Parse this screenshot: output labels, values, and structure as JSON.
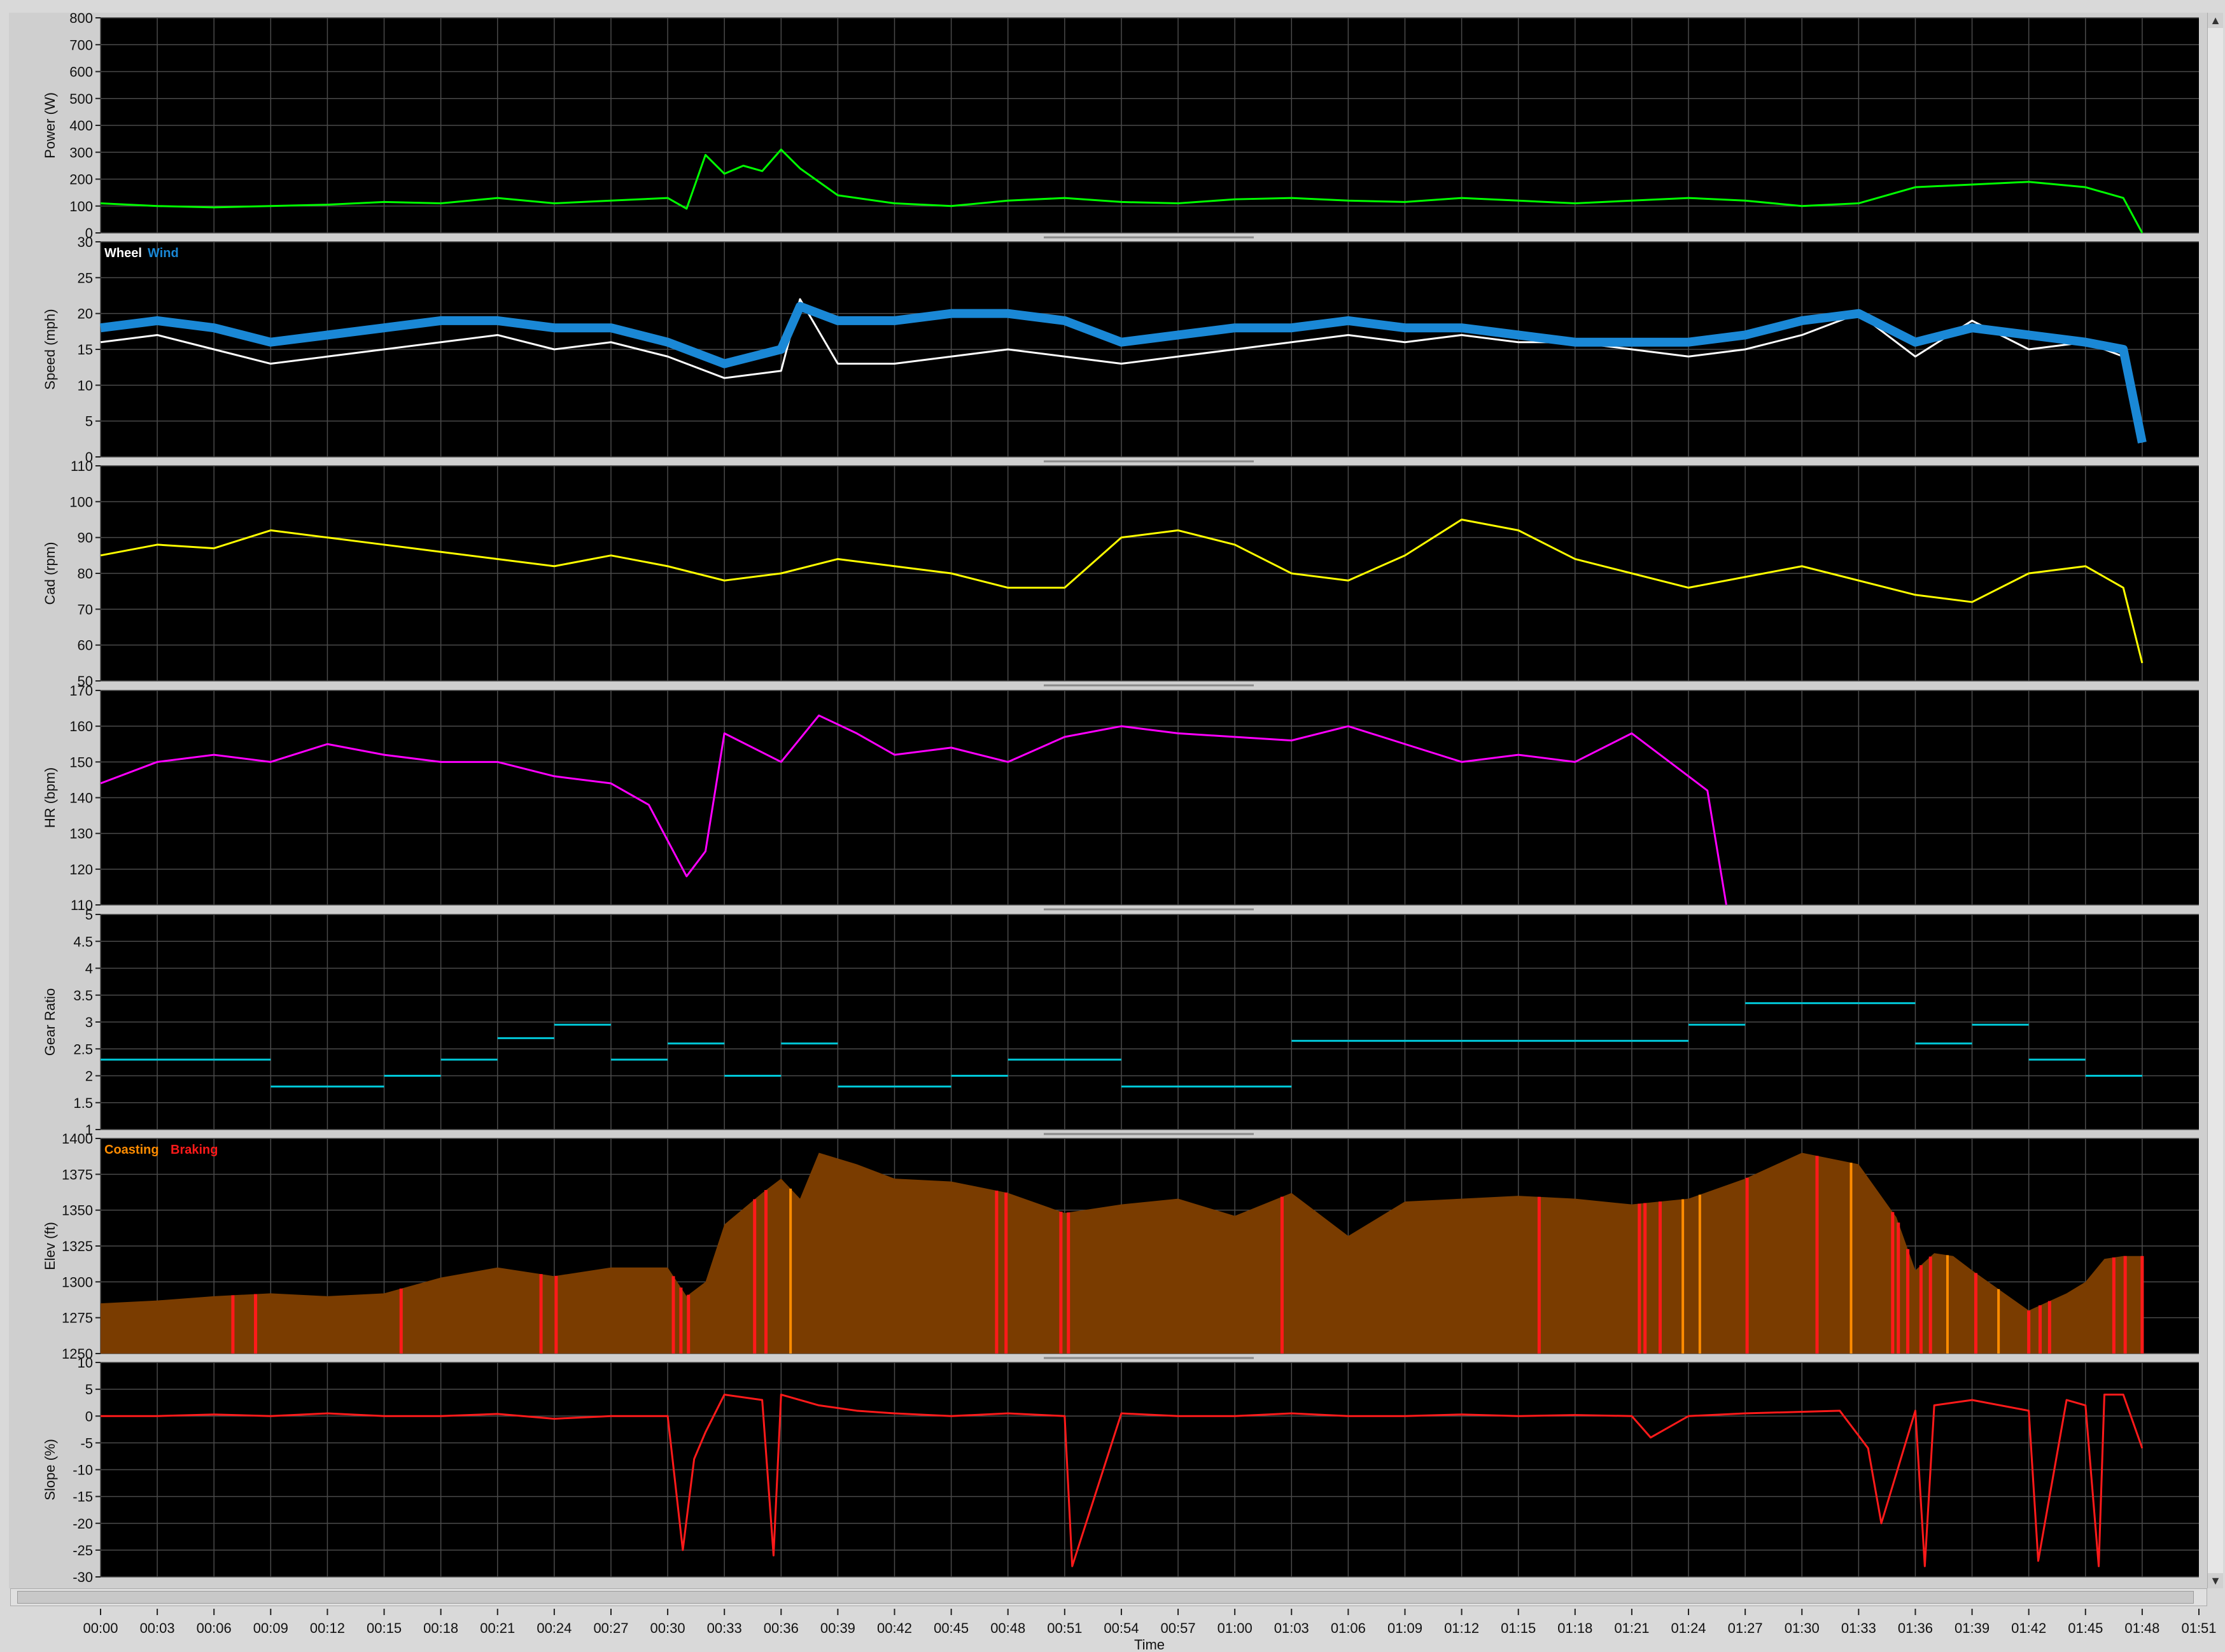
{
  "colors": {
    "power": "#00ff00",
    "wheel": "#ffffff",
    "wind": "#1a88d6",
    "cadence": "#ffff00",
    "hr": "#ff00ff",
    "gear": "#00c8d8",
    "elev_fill": "#7a3c00",
    "coasting": "#ff8c00",
    "braking": "#ff1a1a",
    "slope": "#ff1a1a"
  },
  "chart_data": [
    {
      "type": "line",
      "ylabel": "Power (W)",
      "ylim": [
        0,
        800
      ],
      "ticks": [
        "800",
        "700",
        "600",
        "500",
        "400",
        "300",
        "200",
        "100",
        "0"
      ],
      "series": [
        {
          "x": [
            0,
            3,
            6,
            9,
            12,
            15,
            18,
            21,
            24,
            27,
            30,
            31,
            32,
            33,
            34,
            35,
            36,
            37,
            38,
            39,
            42,
            45,
            48,
            51,
            54,
            57,
            60,
            63,
            66,
            69,
            72,
            75,
            78,
            81,
            84,
            87,
            90,
            93,
            96,
            99,
            102,
            105,
            107,
            108
          ],
          "values": [
            110,
            100,
            95,
            100,
            105,
            115,
            110,
            130,
            110,
            120,
            130,
            90,
            290,
            220,
            250,
            230,
            310,
            240,
            190,
            140,
            110,
            100,
            120,
            130,
            115,
            110,
            125,
            130,
            120,
            115,
            130,
            120,
            110,
            120,
            130,
            120,
            100,
            110,
            170,
            180,
            190,
            170,
            130,
            0
          ]
        }
      ]
    },
    {
      "type": "line",
      "ylabel": "Speed (mph)",
      "ylim": [
        0,
        30
      ],
      "ticks": [
        "30",
        "25",
        "20",
        "15",
        "10",
        "5",
        "0"
      ],
      "legend": [
        "Wheel",
        "Wind"
      ],
      "series": [
        {
          "name": "Wheel",
          "x": [
            0,
            3,
            6,
            9,
            12,
            15,
            18,
            21,
            24,
            27,
            30,
            33,
            36,
            37,
            39,
            42,
            45,
            48,
            51,
            54,
            57,
            60,
            63,
            66,
            69,
            72,
            75,
            78,
            81,
            84,
            87,
            90,
            93,
            96,
            99,
            102,
            105,
            107,
            108
          ],
          "values": [
            16,
            17,
            15,
            13,
            14,
            15,
            16,
            17,
            15,
            16,
            14,
            11,
            12,
            22,
            13,
            13,
            14,
            15,
            14,
            13,
            14,
            15,
            16,
            17,
            16,
            17,
            16,
            16,
            15,
            14,
            15,
            17,
            20,
            14,
            19,
            15,
            16,
            14,
            2
          ]
        },
        {
          "name": "Wind",
          "x": [
            0,
            3,
            6,
            9,
            12,
            15,
            18,
            21,
            24,
            27,
            30,
            33,
            36,
            37,
            39,
            42,
            45,
            48,
            51,
            54,
            57,
            60,
            63,
            66,
            69,
            72,
            75,
            78,
            81,
            84,
            87,
            90,
            93,
            96,
            99,
            102,
            105,
            107,
            108
          ],
          "values": [
            18,
            19,
            18,
            16,
            17,
            18,
            19,
            19,
            18,
            18,
            16,
            13,
            15,
            21,
            19,
            19,
            20,
            20,
            19,
            16,
            17,
            18,
            18,
            19,
            18,
            18,
            17,
            16,
            16,
            16,
            17,
            19,
            20,
            16,
            18,
            17,
            16,
            15,
            2
          ]
        }
      ]
    },
    {
      "type": "line",
      "ylabel": "Cad (rpm)",
      "ylim": [
        50,
        110
      ],
      "ticks": [
        "110",
        "100",
        "90",
        "80",
        "70",
        "60",
        "50"
      ],
      "series": [
        {
          "x": [
            0,
            3,
            6,
            9,
            12,
            15,
            18,
            21,
            24,
            27,
            30,
            33,
            36,
            39,
            42,
            45,
            48,
            51,
            54,
            57,
            60,
            63,
            66,
            69,
            72,
            75,
            78,
            81,
            84,
            87,
            90,
            93,
            96,
            99,
            102,
            105,
            107,
            108
          ],
          "values": [
            85,
            88,
            87,
            92,
            90,
            88,
            86,
            84,
            82,
            85,
            82,
            78,
            80,
            84,
            82,
            80,
            76,
            76,
            90,
            92,
            88,
            80,
            78,
            85,
            95,
            92,
            84,
            80,
            76,
            79,
            82,
            78,
            74,
            72,
            80,
            82,
            76,
            55
          ]
        }
      ]
    },
    {
      "type": "line",
      "ylabel": "HR (bpm)",
      "ylim": [
        110,
        170
      ],
      "ticks": [
        "170",
        "160",
        "150",
        "140",
        "130",
        "120",
        "110"
      ],
      "series": [
        {
          "x": [
            0,
            3,
            6,
            9,
            12,
            15,
            18,
            21,
            24,
            27,
            29,
            31,
            32,
            33,
            36,
            38,
            40,
            42,
            45,
            48,
            51,
            54,
            57,
            60,
            63,
            66,
            69,
            72,
            75,
            78,
            81,
            83,
            85,
            86
          ],
          "values": [
            144,
            150,
            152,
            150,
            155,
            152,
            150,
            150,
            146,
            144,
            138,
            118,
            125,
            158,
            150,
            163,
            158,
            152,
            154,
            150,
            157,
            160,
            158,
            157,
            156,
            160,
            155,
            150,
            152,
            150,
            158,
            150,
            142,
            110
          ]
        }
      ]
    },
    {
      "type": "scatter",
      "ylabel": "Gear Ratio",
      "ylim": [
        1,
        5
      ],
      "ticks": [
        "5",
        "4.5",
        "4",
        "3.5",
        "3",
        "2.5",
        "2",
        "1.5",
        "1"
      ],
      "series": [
        {
          "x": [
            0,
            3,
            6,
            9,
            12,
            15,
            18,
            21,
            24,
            27,
            30,
            33,
            36,
            39,
            42,
            45,
            48,
            51,
            54,
            57,
            60,
            63,
            66,
            69,
            72,
            75,
            78,
            81,
            84,
            87,
            90,
            93,
            96,
            99,
            102,
            105,
            107,
            108
          ],
          "values": [
            2.3,
            2.3,
            2.3,
            1.8,
            1.8,
            2.0,
            2.3,
            2.7,
            2.95,
            2.3,
            2.6,
            2.0,
            2.6,
            1.8,
            1.8,
            2.0,
            2.3,
            2.3,
            1.8,
            1.8,
            1.8,
            2.65,
            2.65,
            2.65,
            2.65,
            2.65,
            2.65,
            2.65,
            2.95,
            3.35,
            3.35,
            3.35,
            2.6,
            2.95,
            2.3,
            2.0,
            2.0,
            2.0
          ]
        }
      ]
    },
    {
      "type": "area",
      "ylabel": "Elev (ft)",
      "ylim": [
        1250,
        1400
      ],
      "ticks": [
        "1400",
        "1375",
        "1350",
        "1325",
        "1300",
        "1275",
        "1250"
      ],
      "legend": [
        "Coasting",
        "Braking"
      ],
      "series": [
        {
          "x": [
            0,
            3,
            6,
            9,
            12,
            15,
            18,
            21,
            24,
            27,
            30,
            31,
            32,
            33,
            35,
            36,
            37,
            38,
            40,
            42,
            45,
            48,
            51,
            54,
            57,
            60,
            63,
            66,
            69,
            72,
            75,
            78,
            81,
            84,
            87,
            90,
            93,
            95,
            96,
            97,
            98,
            99,
            102,
            104,
            105,
            106,
            107,
            108
          ],
          "values": [
            1285,
            1287,
            1290,
            1292,
            1290,
            1292,
            1303,
            1310,
            1304,
            1310,
            1310,
            1290,
            1300,
            1340,
            1362,
            1372,
            1358,
            1390,
            1382,
            1372,
            1370,
            1362,
            1348,
            1354,
            1358,
            1346,
            1362,
            1332,
            1356,
            1358,
            1360,
            1358,
            1354,
            1358,
            1372,
            1390,
            1382,
            1345,
            1308,
            1320,
            1318,
            1308,
            1280,
            1292,
            1300,
            1316,
            1318,
            1318
          ]
        }
      ],
      "braking_x": [
        7,
        8.2,
        15.9,
        23.3,
        24.1,
        30.3,
        30.7,
        31.1,
        34.6,
        35.2,
        47.4,
        47.9,
        50.8,
        51.2,
        62.5,
        76.1,
        81.4,
        81.7,
        82.5,
        87.1,
        90.8,
        94.8,
        95.1,
        95.6,
        96.3,
        96.8,
        99.2,
        102,
        102.6,
        103.1,
        106.5,
        107.1,
        108
      ],
      "coasting_x": [
        36.5,
        83.7,
        84.6,
        92.6,
        97.7,
        100.4
      ]
    },
    {
      "type": "line",
      "ylabel": "Slope (%)",
      "ylim": [
        -30,
        10
      ],
      "ticks": [
        "10",
        "5",
        "0",
        "-5",
        "-10",
        "-15",
        "-20",
        "-25",
        "-30"
      ],
      "series": [
        {
          "x": [
            0,
            3,
            6,
            9,
            12,
            15,
            18,
            21,
            24,
            27,
            30,
            30.8,
            31.4,
            32,
            33,
            35,
            35.6,
            36,
            38,
            40,
            42,
            45,
            48,
            51,
            51.4,
            54,
            57,
            60,
            63,
            66,
            69,
            72,
            75,
            78,
            81,
            82,
            84,
            87,
            92,
            93.5,
            94.2,
            96,
            96.5,
            97,
            99,
            102,
            102.5,
            104,
            105,
            105.7,
            106,
            107,
            108
          ],
          "values": [
            0,
            0,
            0.3,
            0,
            0.5,
            0,
            0,
            0.4,
            -0.5,
            0,
            0,
            -25,
            -8,
            -3,
            4,
            3,
            -26,
            4,
            2,
            1,
            0.5,
            0,
            0.5,
            0,
            -28,
            0.5,
            0,
            0,
            0.5,
            0,
            0,
            0.3,
            0,
            0.2,
            0,
            -4,
            0,
            0.5,
            1,
            -6,
            -20,
            1,
            -28,
            2,
            3,
            1,
            -27,
            3,
            2,
            -28,
            4,
            4,
            -6
          ]
        }
      ]
    }
  ],
  "time_axis": {
    "label": "Time",
    "ticks": [
      "00:00",
      "00:03",
      "00:06",
      "00:09",
      "00:12",
      "00:15",
      "00:18",
      "00:21",
      "00:24",
      "00:27",
      "00:30",
      "00:33",
      "00:36",
      "00:39",
      "00:42",
      "00:45",
      "00:48",
      "00:51",
      "00:54",
      "00:57",
      "01:00",
      "01:03",
      "01:06",
      "01:09",
      "01:12",
      "01:15",
      "01:18",
      "01:21",
      "01:24",
      "01:27",
      "01:30",
      "01:33",
      "01:36",
      "01:39",
      "01:42",
      "01:45",
      "01:48",
      "01:51"
    ]
  }
}
